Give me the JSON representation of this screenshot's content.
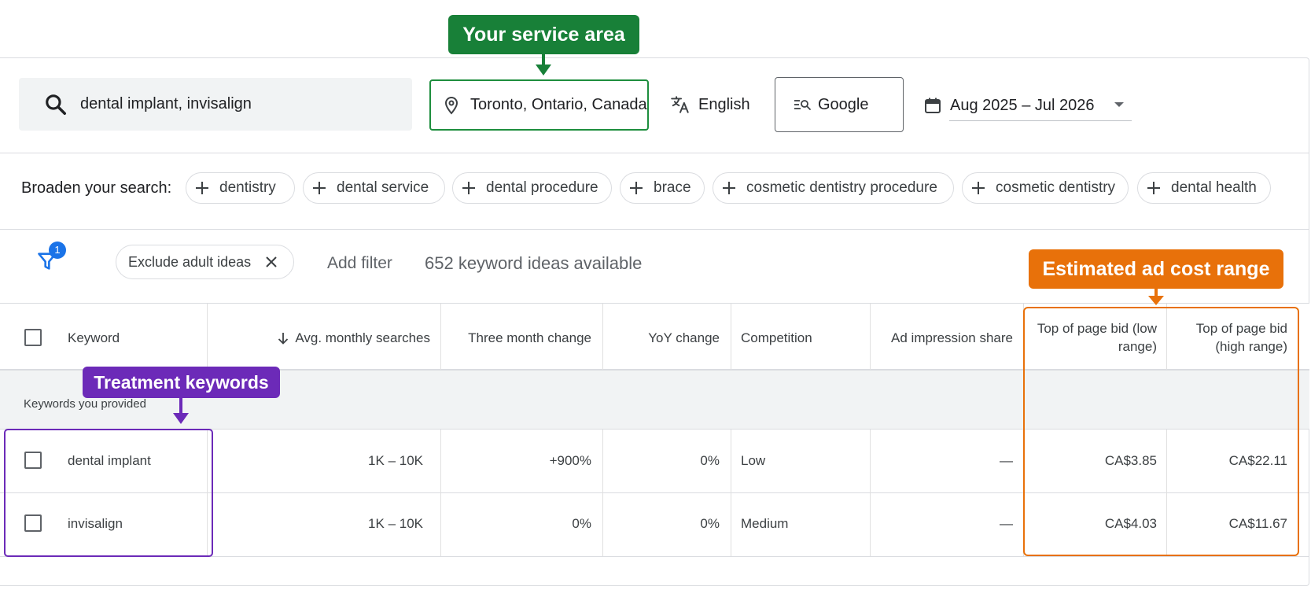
{
  "annotations": {
    "service_area": "Your service area",
    "treatment_keywords": "Treatment keywords",
    "cost_range": "Estimated ad cost range",
    "colors": {
      "green": "#188038",
      "purple": "#6c2ab8",
      "orange": "#e8710a"
    }
  },
  "toolbar": {
    "search_value": "dental implant, invisalign",
    "location": "Toronto, Ontario, Canada",
    "language": "English",
    "network": "Google",
    "date_range": "Aug 2025 – Jul 2026",
    "icons": [
      "search-icon",
      "location-pin-icon",
      "translate-icon",
      "search-network-icon",
      "calendar-icon",
      "dropdown-caret-icon"
    ]
  },
  "broaden": {
    "label": "Broaden your search:",
    "chips": [
      "dentistry",
      "dental service",
      "dental procedure",
      "brace",
      "cosmetic dentistry procedure",
      "cosmetic dentistry",
      "dental health"
    ]
  },
  "filters": {
    "badge_count": "1",
    "active_filter": "Exclude adult ideas",
    "add_filter": "Add filter",
    "ideas_count": "652 keyword ideas available"
  },
  "table": {
    "headers": {
      "keyword": "Keyword",
      "avg_monthly": "Avg. monthly searches",
      "three_month": "Three month change",
      "yoy": "YoY change",
      "competition": "Competition",
      "ad_impression": "Ad impression share",
      "bid_low": "Top of page bid (low range)",
      "bid_high": "Top of page bid (high range)"
    },
    "group_label": "Keywords you provided",
    "rows": [
      {
        "keyword": "dental implant",
        "avg_monthly": "1K – 10K",
        "three_month": "+900%",
        "yoy": "0%",
        "competition": "Low",
        "ad_impression": "—",
        "bid_low": "CA$3.85",
        "bid_high": "CA$22.11"
      },
      {
        "keyword": "invisalign",
        "avg_monthly": "1K – 10K",
        "three_month": "0%",
        "yoy": "0%",
        "competition": "Medium",
        "ad_impression": "—",
        "bid_low": "CA$4.03",
        "bid_high": "CA$11.67"
      }
    ]
  }
}
